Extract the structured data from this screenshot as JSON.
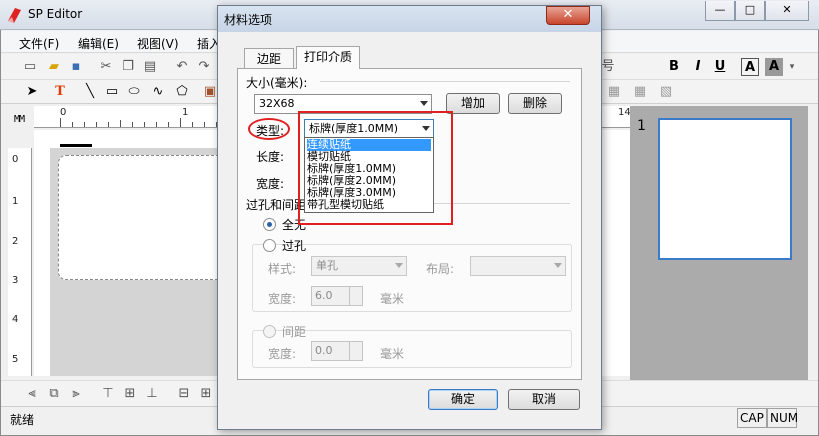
{
  "app": {
    "title": "SP Editor",
    "window_controls": [
      "—",
      "□",
      "✕"
    ]
  },
  "menu": [
    "文件(F)",
    "编辑(E)",
    "视图(V)",
    "插入"
  ],
  "ruler": {
    "unit": "MM",
    "h_labels": [
      "0",
      "1",
      "14"
    ],
    "v_labels": [
      "0",
      "1",
      "2",
      "3",
      "4",
      "5"
    ]
  },
  "preview": {
    "page_number": "1"
  },
  "toolbar_right": {
    "bold": "B",
    "italic": "I",
    "underline": "U",
    "font_size_letter": "A",
    "misc_char": "号"
  },
  "status": {
    "text": "就绪",
    "caps": "CAP",
    "num": "NUM"
  },
  "dialog": {
    "title": "材料选项",
    "close": "✕",
    "tabs": [
      {
        "label": "边距",
        "active": false
      },
      {
        "label": "打印介质",
        "active": true
      }
    ],
    "size_label": "大小(毫米):",
    "size_value": "32X68",
    "add_button": "增加",
    "delete_button": "删除",
    "type_label": "类型:",
    "type_value": "标牌(厚度1.0MM)",
    "length_label": "长度:",
    "width_label": "宽度:",
    "type_options": [
      {
        "label": "连续贴纸",
        "selected": true
      },
      {
        "label": "模切贴纸",
        "selected": false
      },
      {
        "label": "标牌(厚度1.0MM)",
        "selected": false
      },
      {
        "label": "标牌(厚度2.0MM)",
        "selected": false
      },
      {
        "label": "标牌(厚度3.0MM)",
        "selected": false
      },
      {
        "label": "带孔型模切贴纸",
        "selected": false
      }
    ],
    "hole_gap_label": "过孔和间距",
    "radio_none": "全无",
    "radio_hole": "过孔",
    "style_label": "样式:",
    "style_value": "单孔",
    "layout_label": "布局:",
    "layout_value": "",
    "hole_width_label": "宽度:",
    "hole_width_value": "6.0",
    "hole_unit": "毫米",
    "radio_gap": "间距",
    "gap_width_label": "宽度:",
    "gap_width_value": "0.0",
    "gap_unit": "毫米",
    "ok_button": "确定",
    "cancel_button": "取消"
  }
}
